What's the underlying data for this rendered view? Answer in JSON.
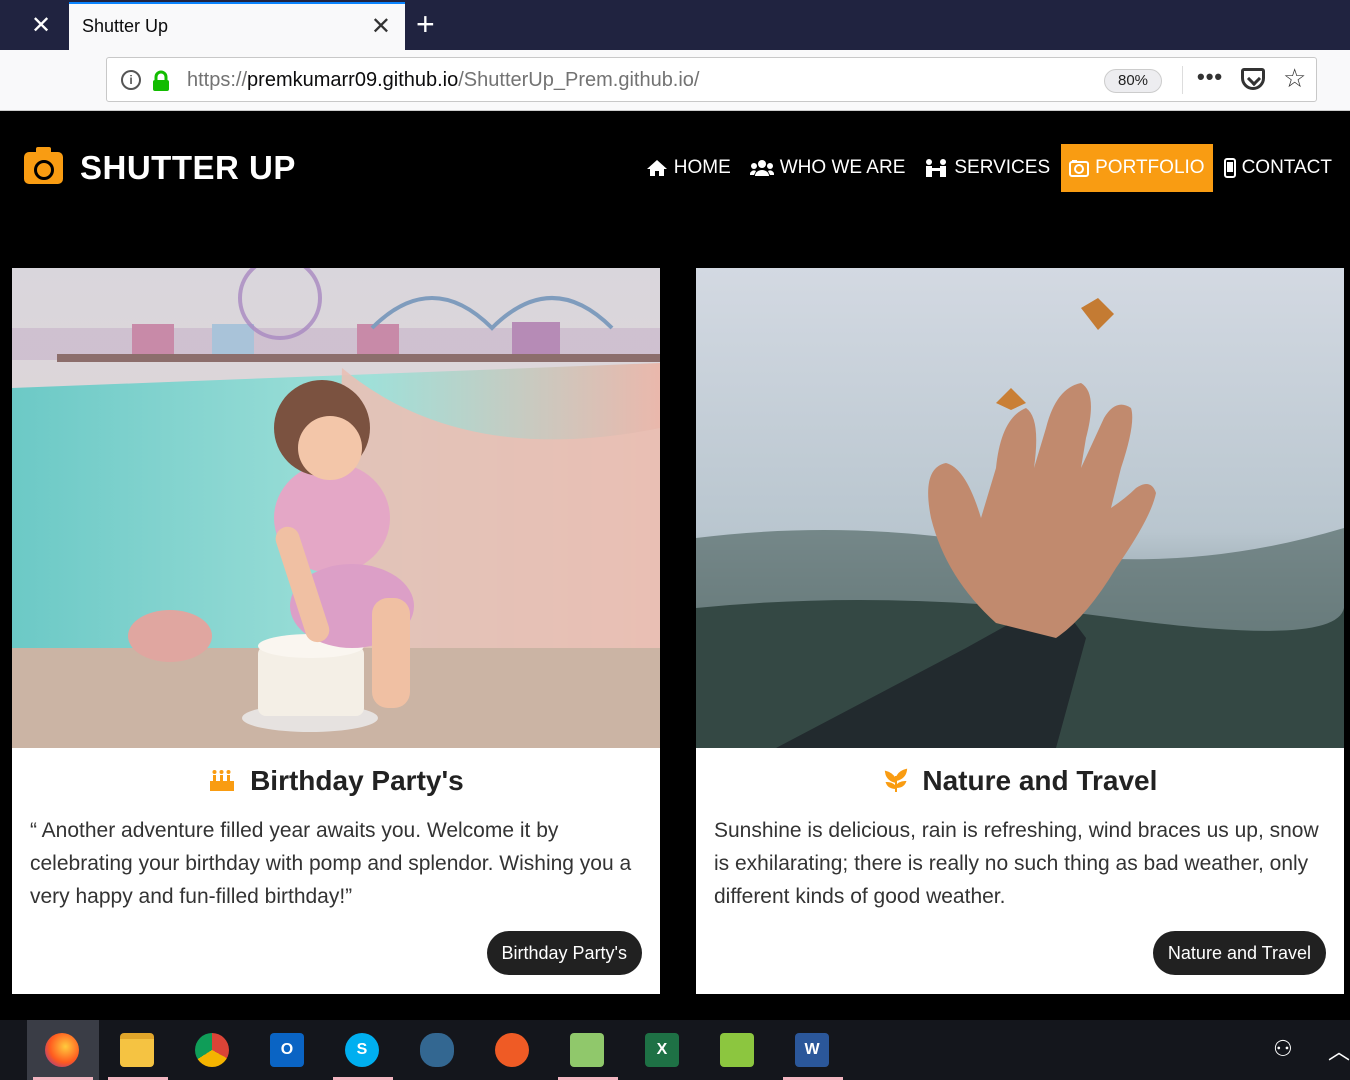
{
  "browser": {
    "tab_title": "Shutter Up",
    "url_prefix": "https://",
    "url_host": "premkumarr09.github.io",
    "url_path": "/ShutterUp_Prem.github.io/",
    "zoom": "80%"
  },
  "site": {
    "brand": "SHUTTER UP",
    "menu": [
      {
        "label": "HOME",
        "icon": "home-icon"
      },
      {
        "label": "WHO WE ARE",
        "icon": "users-icon"
      },
      {
        "label": "SERVICES",
        "icon": "services-icon"
      },
      {
        "label": "PORTFOLIO",
        "icon": "camera-retro-icon",
        "active": true
      },
      {
        "label": "CONTACT",
        "icon": "mobile-icon"
      }
    ],
    "accent_color": "#f99c12"
  },
  "cards": [
    {
      "title": "Birthday Party's",
      "icon": "birthday-cake-icon",
      "text": "“ Another adventure filled year awaits you. Welcome it by celebrating your birthday with pomp and splendor. Wishing you a very happy and fun-filled birthday!”",
      "button": "Birthday Party's"
    },
    {
      "title": "Nature and Travel",
      "icon": "leaf-icon",
      "text": "Sunshine is delicious, rain is refreshing, wind braces us up, snow is exhilarating; there is really no such thing as bad weather, only different kinds of good weather.",
      "button": "Nature and Travel"
    }
  ],
  "taskbar": {
    "apps": [
      "firefox",
      "file-explorer",
      "chrome",
      "outlook",
      "skype",
      "postgresql",
      "postman",
      "notepad-plus-plus",
      "excel",
      "on-screen-keyboard",
      "word"
    ]
  }
}
